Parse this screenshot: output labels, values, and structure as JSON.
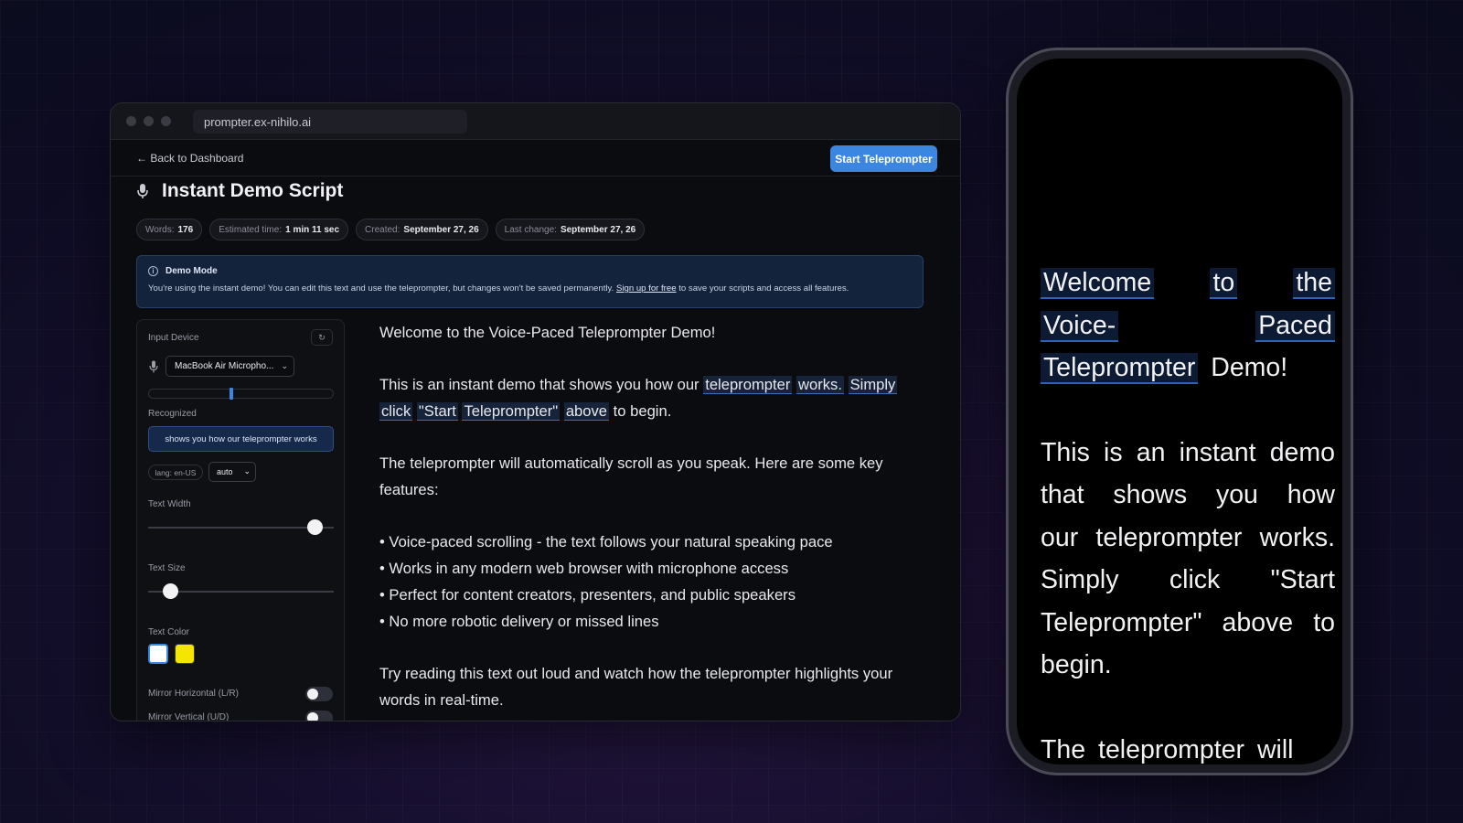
{
  "browser": {
    "url": "prompter.ex-nihilo.ai",
    "back_label": "← Back to Dashboard",
    "start_label": "Start Teleprompter"
  },
  "script": {
    "title": "Instant Demo Script",
    "meta": {
      "words_label": "Words:",
      "words": "176",
      "time_label": "Estimated time:",
      "time": "1 min 11 sec",
      "created_label": "Created:",
      "created": "September 27, 26",
      "changed_label": "Last change:",
      "changed": "September 27, 26"
    },
    "notice": {
      "title": "Demo Mode",
      "body_before": "You're using the instant demo! You can edit this text and use the teleprompter, but changes won't be saved permanently.",
      "link": "Sign up for free",
      "body_after": "to save your scripts and access all features."
    },
    "body": {
      "p1": "Welcome to the Voice-Paced Teleprompter Demo!",
      "p2_a": "This is an instant demo that shows you how our",
      "p2_hl1": "teleprompter",
      "p2_hl2": "works.",
      "p2_hl3": "Simply",
      "p2_hl4": "click",
      "p2_hl5": "\"Start",
      "p2_hl6": "Teleprompter\"",
      "p2_hl7": "above",
      "p2_b": "to begin.",
      "p3": "The teleprompter will automatically scroll as you speak. Here are some key features:",
      "bullets": [
        "• Voice-paced scrolling - the text follows your natural speaking pace",
        "• Works in any modern web browser with microphone access",
        "• Perfect for content creators, presenters, and public speakers",
        "• No more robotic delivery or missed lines"
      ],
      "p4": "Try reading this text out loud and watch how the teleprompter highlights your words in real-time."
    }
  },
  "panel": {
    "input_device_label": "Input Device",
    "device_value": "MacBook Air Micropho...",
    "recognized_label": "Recognized",
    "recognized_text": "shows you how our teleprompter works",
    "lang": "lang: en-US",
    "lang_mode": "auto",
    "text_width_label": "Text Width",
    "text_width_value": 0.9,
    "text_size_label": "Text Size",
    "text_size_value": 0.12,
    "text_color_label": "Text Color",
    "colors": [
      "#ffffff",
      "#f5e600"
    ],
    "selected_color": "#ffffff",
    "mirror_h_label": "Mirror Horizontal (L/R)",
    "mirror_v_label": "Mirror Vertical (U/D)",
    "mirror_h": false,
    "mirror_v": false
  },
  "phone": {
    "w1": "Welcome",
    "w2": "to",
    "w3": "the",
    "w4": "Voice-",
    "w5": "Paced",
    "w6": "Teleprompter",
    "w7": "Demo!",
    "p2": "This is an instant demo that shows you how our teleprompter works. Simply click \"Start Teleprompter\" above to begin.",
    "p3": "The teleprompter will"
  }
}
